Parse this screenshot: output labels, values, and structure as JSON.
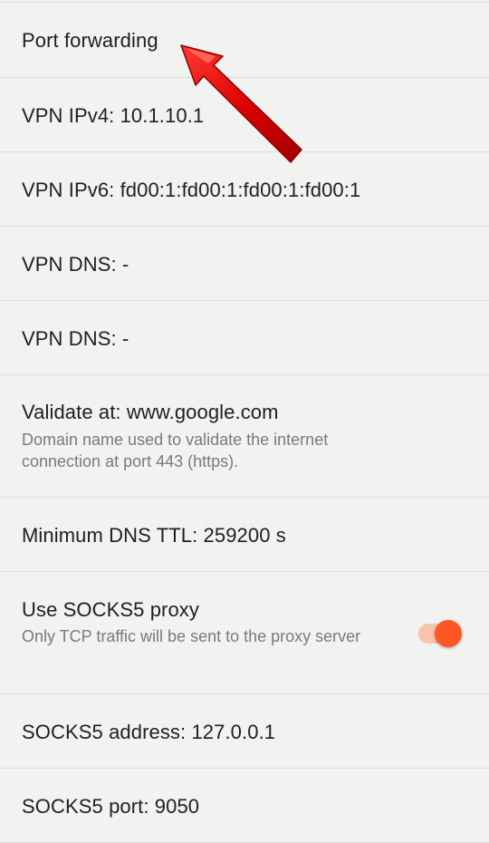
{
  "settings": {
    "port_forwarding": "Port forwarding",
    "vpn_ipv4": "VPN IPv4: 10.1.10.1",
    "vpn_ipv6": "VPN IPv6: fd00:1:fd00:1:fd00:1:fd00:1",
    "vpn_dns_1": "VPN DNS: -",
    "vpn_dns_2": "VPN DNS: -",
    "validate_title": "Validate at: www.google.com",
    "validate_summary": "Domain name used to validate the internet connection at port 443 (https).",
    "min_dns_ttl": "Minimum DNS TTL: 259200 s",
    "socks5_title": "Use SOCKS5 proxy",
    "socks5_summary": "Only TCP traffic will be sent to the proxy server",
    "socks5_enabled": true,
    "socks5_address": "SOCKS5 address: 127.0.0.1",
    "socks5_port": "SOCKS5 port: 9050"
  },
  "colors": {
    "accent": "#ff5722",
    "accent_track": "#f8c4ad",
    "annotation_arrow": "#d80000",
    "background": "#f2f2f1"
  },
  "icons": {
    "annotation": "red-arrow-icon"
  }
}
